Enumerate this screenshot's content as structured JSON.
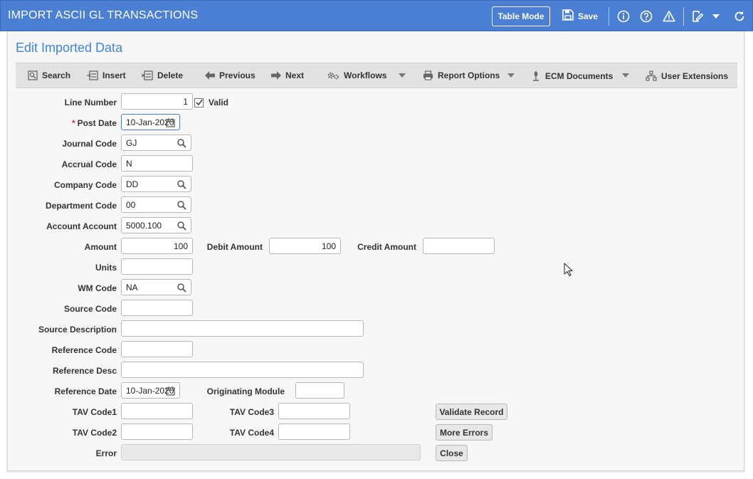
{
  "app": {
    "title": "IMPORT ASCII GL TRANSACTIONS",
    "table_mode_label": "Table Mode",
    "save_label": "Save"
  },
  "page": {
    "title": "Edit Imported Data"
  },
  "toolbar": {
    "search": "Search",
    "insert": "Insert",
    "delete": "Delete",
    "previous": "Previous",
    "next": "Next",
    "workflows": "Workflows",
    "report_options": "Report Options",
    "ecm_documents": "ECM Documents",
    "user_extensions": "User Extensions"
  },
  "form": {
    "line_number": {
      "label": "Line Number",
      "value": "1"
    },
    "valid": {
      "label": "Valid",
      "checked": true
    },
    "post_date": {
      "required_mark": "*",
      "label": "Post Date",
      "value": "10-Jan-2020"
    },
    "journal_code": {
      "label": "Journal Code",
      "value": "GJ"
    },
    "accrual_code": {
      "label": "Accrual Code",
      "value": "N"
    },
    "company_code": {
      "label": "Company Code",
      "value": "DD"
    },
    "department_code": {
      "label": "Department Code",
      "value": "00"
    },
    "account_account": {
      "label": "Account Account",
      "value": "5000.100"
    },
    "amount": {
      "label": "Amount",
      "value": "100"
    },
    "debit_amount": {
      "label": "Debit Amount",
      "value": "100"
    },
    "credit_amount": {
      "label": "Credit Amount",
      "value": ""
    },
    "units": {
      "label": "Units",
      "value": ""
    },
    "wm_code": {
      "label": "WM Code",
      "value": "NA"
    },
    "source_code": {
      "label": "Source Code",
      "value": ""
    },
    "source_description": {
      "label": "Source Description",
      "value": ""
    },
    "reference_code": {
      "label": "Reference Code",
      "value": ""
    },
    "reference_desc": {
      "label": "Reference Desc",
      "value": ""
    },
    "reference_date": {
      "label": "Reference Date",
      "value": "10-Jan-2020"
    },
    "originating_module": {
      "label": "Originating Module",
      "value": ""
    },
    "tav_code1": {
      "label": "TAV Code1",
      "value": ""
    },
    "tav_code2": {
      "label": "TAV Code2",
      "value": ""
    },
    "tav_code3": {
      "label": "TAV Code3",
      "value": ""
    },
    "tav_code4": {
      "label": "TAV Code4",
      "value": ""
    },
    "error": {
      "label": "Error",
      "value": ""
    }
  },
  "actions": {
    "validate_record": "Validate Record",
    "more_errors": "More Errors",
    "close": "Close"
  },
  "colors": {
    "titlebar": "#4a7fd4",
    "page_title": "#3f86d8",
    "panel_bg": "#f7f7f7",
    "toolbar_bg": "#e2e2e2"
  }
}
